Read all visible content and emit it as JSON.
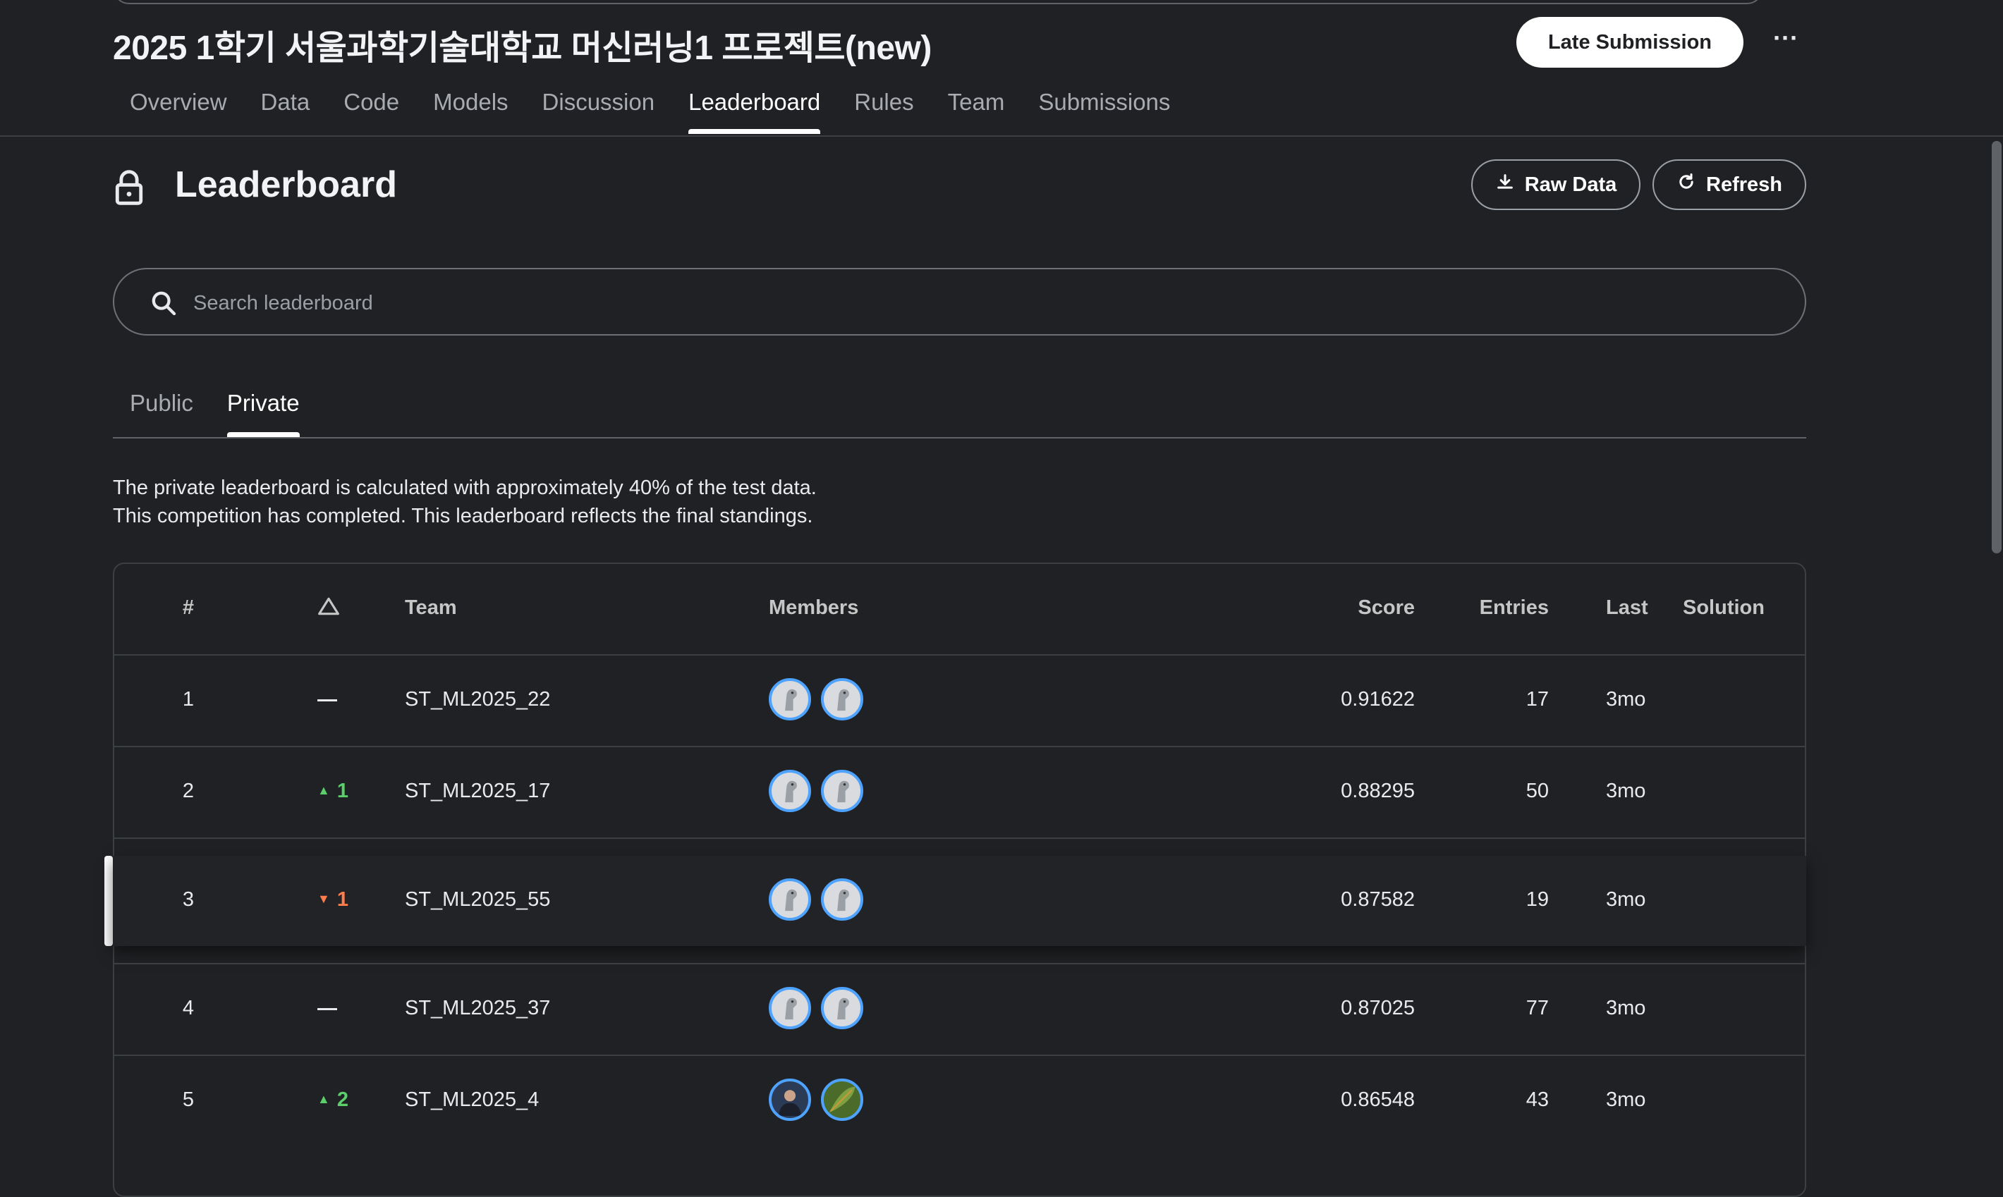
{
  "competition": {
    "title": "2025 1학기 서울과학기술대학교 머신러닝1 프로젝트(new)",
    "late_submission_label": "Late Submission",
    "more_label": "···"
  },
  "nav": {
    "tabs": [
      "Overview",
      "Data",
      "Code",
      "Models",
      "Discussion",
      "Leaderboard",
      "Rules",
      "Team",
      "Submissions"
    ],
    "active": "Leaderboard"
  },
  "leaderboard": {
    "title": "Leaderboard",
    "raw_data_label": "Raw Data",
    "refresh_label": "Refresh",
    "search_placeholder": "Search leaderboard",
    "subtabs": [
      "Public",
      "Private"
    ],
    "active_subtab": "Private",
    "description_line1": "The private leaderboard is calculated with approximately 40% of the test data.",
    "description_line2": "This competition has completed. This leaderboard reflects the final standings."
  },
  "table": {
    "headers": {
      "rank": "#",
      "team": "Team",
      "members": "Members",
      "score": "Score",
      "entries": "Entries",
      "last": "Last",
      "solution": "Solution"
    },
    "rows": [
      {
        "rank": "1",
        "delta_dir": "none",
        "delta": "",
        "team": "ST_ML2025_22",
        "score": "0.91622",
        "entries": "17",
        "last": "3mo"
      },
      {
        "rank": "2",
        "delta_dir": "up",
        "delta": "1",
        "team": "ST_ML2025_17",
        "score": "0.88295",
        "entries": "50",
        "last": "3mo"
      },
      {
        "rank": "3",
        "delta_dir": "down",
        "delta": "1",
        "team": "ST_ML2025_55",
        "score": "0.87582",
        "entries": "19",
        "last": "3mo"
      },
      {
        "rank": "4",
        "delta_dir": "none",
        "delta": "",
        "team": "ST_ML2025_37",
        "score": "0.87025",
        "entries": "77",
        "last": "3mo"
      },
      {
        "rank": "5",
        "delta_dir": "up",
        "delta": "2",
        "team": "ST_ML2025_4",
        "score": "0.86548",
        "entries": "43",
        "last": "3mo"
      }
    ]
  },
  "colors": {
    "background": "#202124",
    "up": "#5bcf6b",
    "down": "#ff7c4d",
    "avatar_ring": "#4da3ff"
  }
}
